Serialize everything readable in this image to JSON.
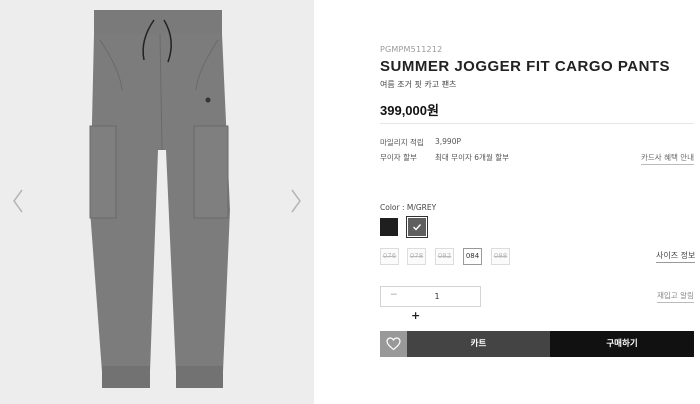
{
  "product": {
    "code": "PGMPM511212",
    "title": "SUMMER JOGGER FIT CARGO PANTS",
    "subtitle": "여름 조거 핏 카고 팬츠",
    "price": "399,000원",
    "image_icon": "pants-product-image"
  },
  "details": {
    "mileage_label": "마일리지 적립",
    "mileage_value": "3,990P",
    "installment_label": "무이자 할부",
    "installment_value": "최대 무이자 6개월 할부",
    "card_benefit_link": "카드사 혜택 안내"
  },
  "color": {
    "label": "Color : M/GREY",
    "swatches": [
      {
        "name": "black",
        "hex": "#1f1f1f",
        "selected": false
      },
      {
        "name": "m-grey",
        "hex": "#5f5f5f",
        "selected": true
      }
    ]
  },
  "sizes": {
    "options": [
      {
        "label": "076",
        "available": false
      },
      {
        "label": "078",
        "available": false
      },
      {
        "label": "082",
        "available": false
      },
      {
        "label": "084",
        "available": true
      },
      {
        "label": "088",
        "available": false
      }
    ],
    "guide_link": "사이즈 정보"
  },
  "quantity": {
    "minus": "−",
    "value": "1",
    "plus": "+",
    "restock_link": "재입고 알림"
  },
  "actions": {
    "wish_icon": "heart-icon",
    "cart_label": "카트",
    "buy_label": "구매하기"
  },
  "gallery": {
    "prev_icon": "chevron-left-icon",
    "next_icon": "chevron-right-icon"
  }
}
